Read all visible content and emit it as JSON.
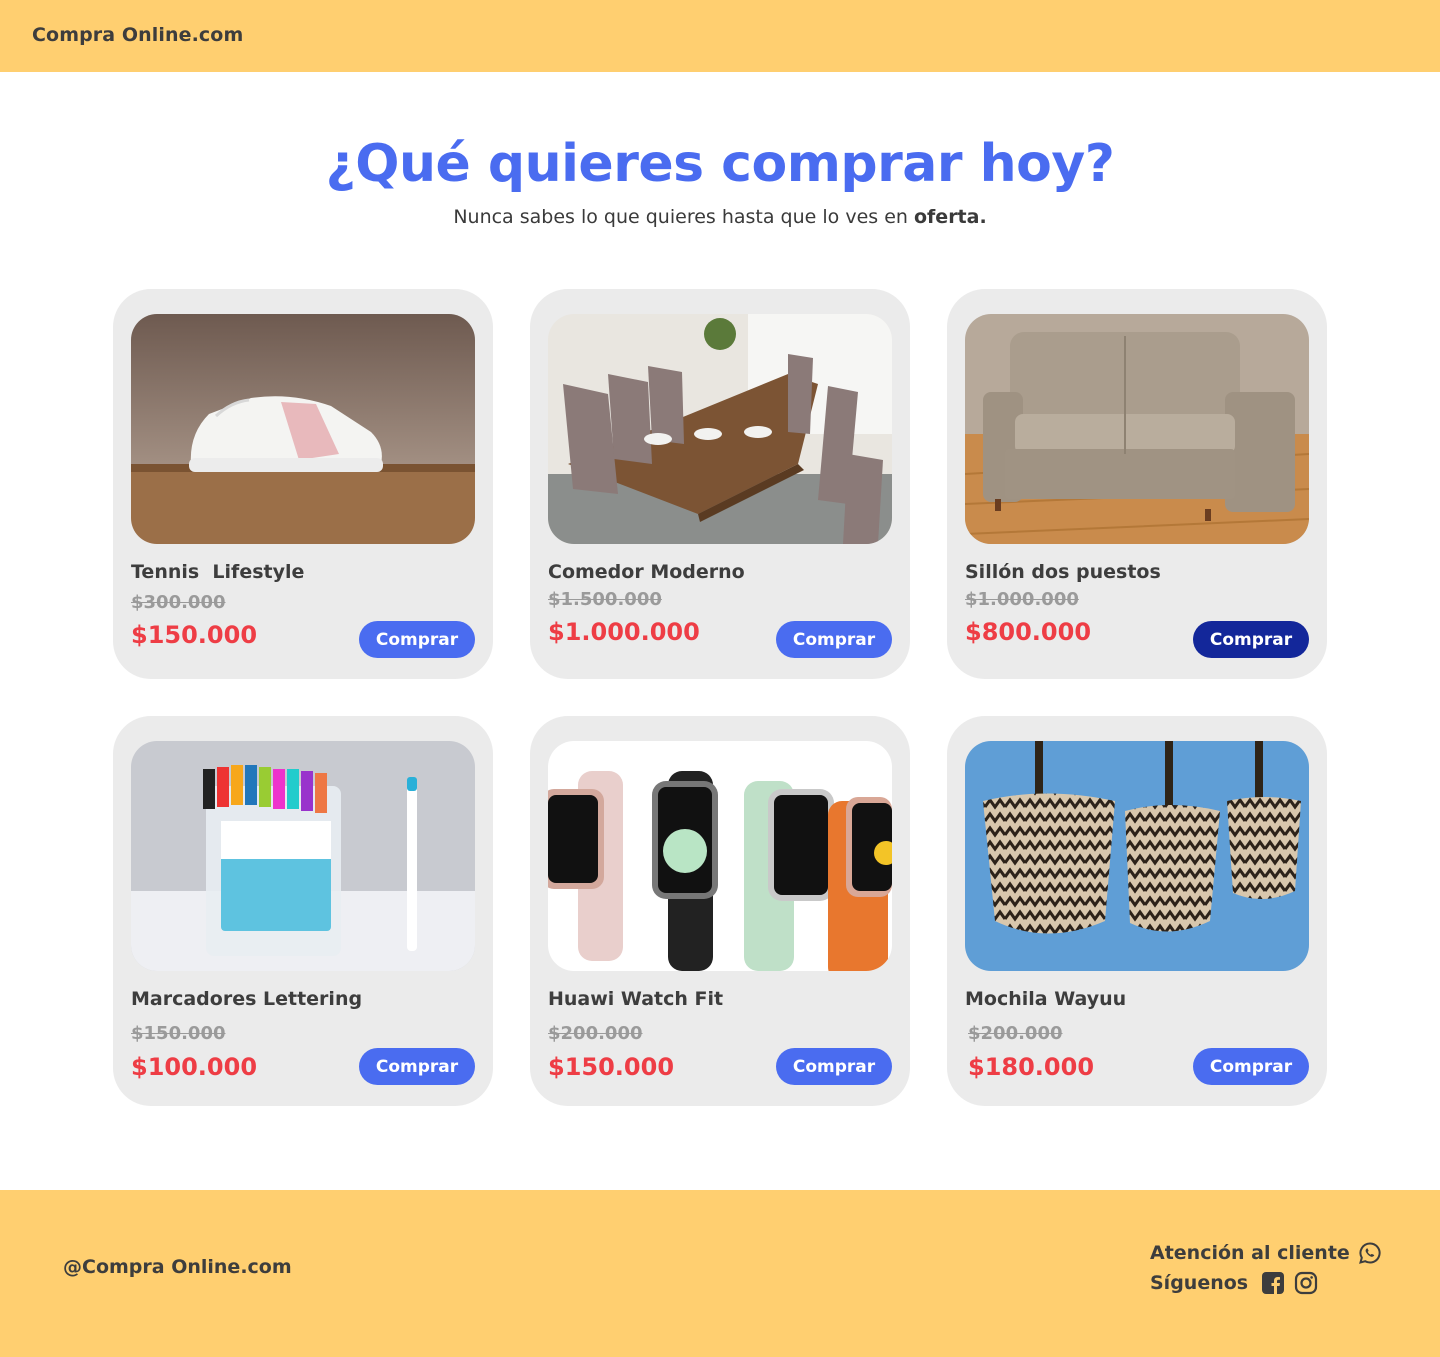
{
  "header": {
    "brand": "Compra Online.com"
  },
  "hero": {
    "title": "¿Qué quieres comprar hoy?",
    "subtitle": "Nunca sabes lo que quieres hasta que lo ves en ",
    "subtitle_bold": "oferta."
  },
  "products": [
    {
      "name": "Tennis  Lifestyle",
      "old_price": "$300.000",
      "price": "$150.000",
      "button": "Comprar",
      "image": "sneaker"
    },
    {
      "name": "Comedor Moderno",
      "old_price": "$1.500.000",
      "price": "$1.000.000",
      "button": "Comprar",
      "image": "dining-table"
    },
    {
      "name": "Sillón dos puestos",
      "old_price": "$1.000.000",
      "price": "$800.000",
      "button": "Comprar",
      "image": "sofa"
    },
    {
      "name": "Marcadores Lettering",
      "old_price": "$150.000",
      "price": "$100.000",
      "button": "Comprar",
      "image": "markers"
    },
    {
      "name": "Huawi Watch Fit",
      "old_price": "$200.000",
      "price": "$150.000",
      "button": "Comprar",
      "image": "smartwatches"
    },
    {
      "name": "Mochila Wayuu",
      "old_price": "$200.000",
      "price": "$180.000",
      "button": "Comprar",
      "image": "woven-bags"
    }
  ],
  "footer": {
    "handle": "@Compra Online.com",
    "support_label": "Atención al cliente",
    "follow_label": "Síguenos",
    "icons": [
      "whatsapp-icon",
      "facebook-icon",
      "instagram-icon"
    ]
  },
  "colors": {
    "bar": "#ffcf70",
    "accent": "#4a6cf0",
    "accent_active": "#13279a",
    "price": "#ee3d45",
    "card": "#ebebeb"
  }
}
